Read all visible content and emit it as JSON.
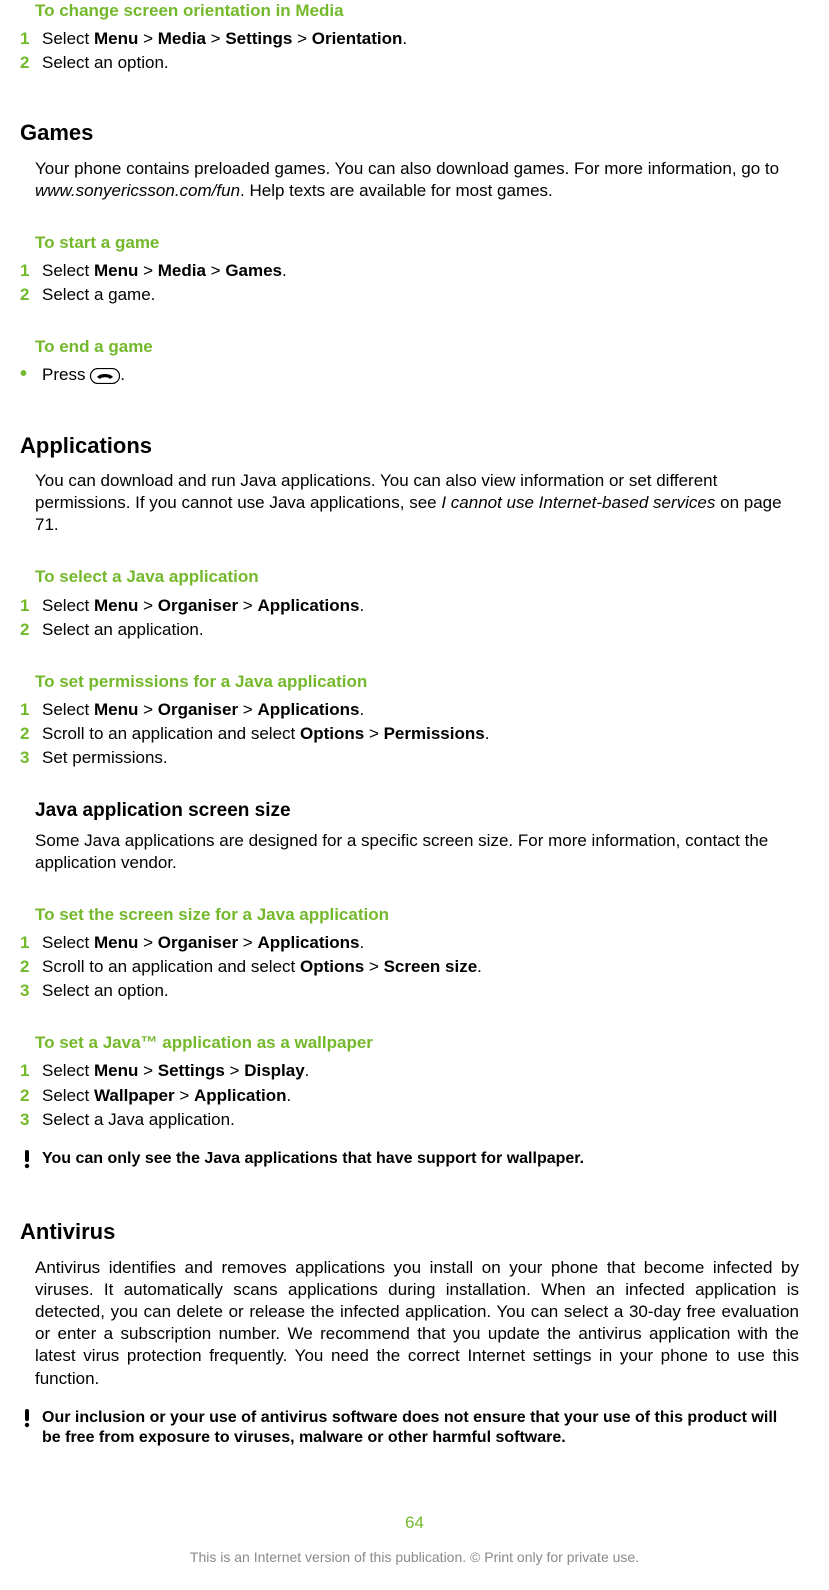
{
  "tasks": {
    "orientation_title": "To change screen orientation in Media",
    "orientation_step1_pre": "Select ",
    "orientation_step1_menu": "Menu",
    "orientation_step1_gt1": " > ",
    "orientation_step1_media": "Media",
    "orientation_step1_gt2": " > ",
    "orientation_step1_settings": "Settings",
    "orientation_step1_gt3": " > ",
    "orientation_step1_orient": "Orientation",
    "orientation_step1_end": ".",
    "orientation_step2": "Select an option.",
    "start_game_title": "To start a game",
    "start_game_step1_pre": "Select ",
    "start_game_step1_menu": "Menu",
    "start_game_step1_gt1": " > ",
    "start_game_step1_media": "Media",
    "start_game_step1_gt2": " > ",
    "start_game_step1_games": "Games",
    "start_game_step1_end": ".",
    "start_game_step2": "Select a game.",
    "end_game_title": "To end a game",
    "end_game_step_pre": "Press ",
    "end_game_step_end": ".",
    "select_java_title": "To select a Java application",
    "select_java_step1_pre": "Select ",
    "select_java_step1_menu": "Menu",
    "select_java_step1_gt1": " > ",
    "select_java_step1_org": "Organiser",
    "select_java_step1_gt2": " > ",
    "select_java_step1_apps": "Applications",
    "select_java_step1_end": ".",
    "select_java_step2": "Select an application.",
    "perm_title": "To set permissions for a Java application",
    "perm_step1_pre": "Select ",
    "perm_step1_menu": "Menu",
    "perm_step1_gt1": " > ",
    "perm_step1_org": "Organiser",
    "perm_step1_gt2": " > ",
    "perm_step1_apps": "Applications",
    "perm_step1_end": ".",
    "perm_step2_pre": "Scroll to an application and select ",
    "perm_step2_opt": "Options",
    "perm_step2_gt": " > ",
    "perm_step2_perm": "Permissions",
    "perm_step2_end": ".",
    "perm_step3": "Set permissions.",
    "size_title": "To set the screen size for a Java application",
    "size_step1_pre": "Select ",
    "size_step1_menu": "Menu",
    "size_step1_gt1": " > ",
    "size_step1_org": "Organiser",
    "size_step1_gt2": " > ",
    "size_step1_apps": "Applications",
    "size_step1_end": ".",
    "size_step2_pre": "Scroll to an application and select ",
    "size_step2_opt": "Options",
    "size_step2_gt": " > ",
    "size_step2_size": "Screen size",
    "size_step2_end": ".",
    "size_step3": "Select an option.",
    "wall_title": "To set a Java™ application as a wallpaper",
    "wall_step1_pre": "Select ",
    "wall_step1_menu": "Menu",
    "wall_step1_gt1": " > ",
    "wall_step1_set": "Settings",
    "wall_step1_gt2": " > ",
    "wall_step1_disp": "Display",
    "wall_step1_end": ".",
    "wall_step2_pre": "Select ",
    "wall_step2_wp": "Wallpaper",
    "wall_step2_gt": " > ",
    "wall_step2_app": "Application",
    "wall_step2_end": ".",
    "wall_step3": "Select a Java application."
  },
  "sections": {
    "games_h": "Games",
    "games_para_pre": "Your phone contains preloaded games. You can also download games. For more information, go to ",
    "games_para_link": "www.sonyericsson.com/fun",
    "games_para_post": ". Help texts are available for most games.",
    "apps_h": "Applications",
    "apps_para_pre": "You can download and run Java applications. You can also view information or set different permissions. If you cannot use Java applications, see ",
    "apps_para_link": "I cannot use Internet-based services",
    "apps_para_post": " on page 71.",
    "java_size_h": "Java application screen size",
    "java_size_para": "Some Java applications are designed for a specific screen size. For more information, contact the application vendor.",
    "antivirus_h": "Antivirus",
    "antivirus_para": "Antivirus identifies and removes applications you install on your phone that become infected by viruses. It automatically scans applications during installation. When an infected application is detected, you can delete or release the infected application. You can select a 30-day free evaluation or enter a subscription number. We recommend that you update the antivirus application with the latest virus protection frequently. You need the correct Internet settings in your phone to use this function."
  },
  "notes": {
    "wallpaper_note": "You can only see the Java applications that have support for wallpaper.",
    "antivirus_note": "Our inclusion or your use of antivirus software does not ensure that your use of this product will be free from exposure to viruses, malware or other harmful software."
  },
  "nums": {
    "n1": "1",
    "n2": "2",
    "n3": "3"
  },
  "page_number": "64",
  "footer": "This is an Internet version of this publication. © Print only for private use."
}
